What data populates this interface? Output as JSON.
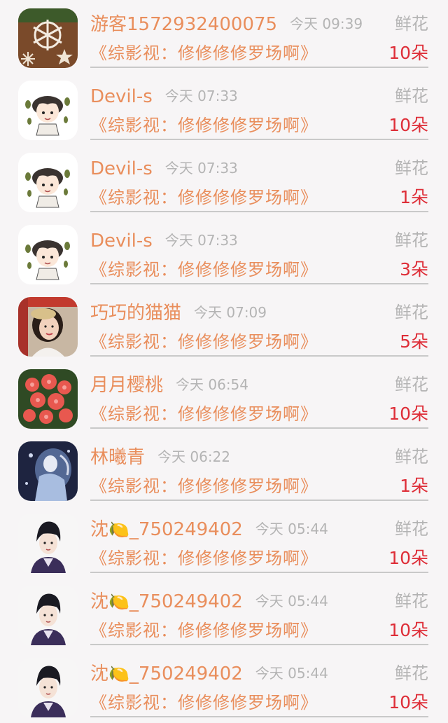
{
  "gift_list": [
    {
      "user": "游客1572932400075",
      "time": "今天 09:39",
      "gift": "鲜花",
      "book": "《综影视：修修修修罗场啊》",
      "count": "10朵",
      "avatar": "snowflake-avatar"
    },
    {
      "user": "Devil-s",
      "time": "今天 07:33",
      "gift": "鲜花",
      "book": "《综影视：修修修修罗场啊》",
      "count": "10朵",
      "avatar": "cartoon-girl-avatar"
    },
    {
      "user": "Devil-s",
      "time": "今天 07:33",
      "gift": "鲜花",
      "book": "《综影视：修修修修罗场啊》",
      "count": "1朵",
      "avatar": "cartoon-girl-avatar"
    },
    {
      "user": "Devil-s",
      "time": "今天 07:33",
      "gift": "鲜花",
      "book": "《综影视：修修修修罗场啊》",
      "count": "3朵",
      "avatar": "cartoon-girl-avatar"
    },
    {
      "user": "巧巧的猫猫",
      "time": "今天 07:09",
      "gift": "鲜花",
      "book": "《综影视：修修修修罗场啊》",
      "count": "5朵",
      "avatar": "woman-photo-avatar"
    },
    {
      "user": "月月樱桃",
      "time": "今天 06:54",
      "gift": "鲜花",
      "book": "《综影视：修修修修罗场啊》",
      "count": "10朵",
      "avatar": "red-flowers-avatar"
    },
    {
      "user": "林曦青",
      "time": "今天 06:22",
      "gift": "鲜花",
      "book": "《综影视：修修修修罗场啊》",
      "count": "1朵",
      "avatar": "fantasy-art-avatar"
    },
    {
      "user_prefix": "沈",
      "user_emoji": "🍋",
      "user_suffix": "_750249402",
      "time": "今天 05:44",
      "gift": "鲜花",
      "book": "《综影视：修修修修罗场啊》",
      "count": "10朵",
      "avatar": "anime-man-avatar"
    },
    {
      "user_prefix": "沈",
      "user_emoji": "🍋",
      "user_suffix": "_750249402",
      "time": "今天 05:44",
      "gift": "鲜花",
      "book": "《综影视：修修修修罗场啊》",
      "count": "10朵",
      "avatar": "anime-man-avatar"
    },
    {
      "user_prefix": "沈",
      "user_emoji": "🍋",
      "user_suffix": "_750249402",
      "time": "今天 05:44",
      "gift": "鲜花",
      "book": "《综影视：修修修修罗场啊》",
      "count": "10朵",
      "avatar": "anime-man-avatar"
    }
  ],
  "colors": {
    "name": "#e98e5c",
    "count": "#de2e38",
    "muted": "#b4b4b4",
    "background": "#f7f5f6"
  }
}
